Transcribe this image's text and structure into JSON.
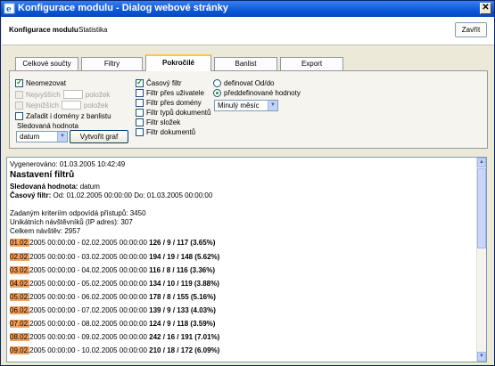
{
  "window": {
    "title": "Konfigurace modulu - Dialog webové stránky",
    "close_glyph": "✕"
  },
  "header": {
    "label": "Konfigurace modulu",
    "module": "Statistika",
    "close_button": "Zavřít"
  },
  "tabs": [
    {
      "label": "Celkové součty",
      "active": false
    },
    {
      "label": "Filtry",
      "active": false
    },
    {
      "label": "Pokročilé",
      "active": true
    },
    {
      "label": "Banlist",
      "active": false
    },
    {
      "label": "Export",
      "active": false
    }
  ],
  "options": {
    "neomezovat": "Neomezovat",
    "nejvyssich": "Nejvyšších",
    "nejnizsich": "Nejnižších",
    "polozek": "položek",
    "zaradit": "Zařadit i domény z banlistu",
    "sledovana_label": "Sledovaná hodnota",
    "sledovana_value": "datum",
    "vytvorit_graf": "Vytvořit graf",
    "casovy_filtr": "Časový filtr",
    "filtr_uzivatele": "Filtr přes uživatele",
    "filtr_domeny": "Filtr přes domény",
    "filtr_typu": "Filtr typů dokumentů",
    "filtr_slozek": "Filtr složek",
    "filtr_dokumentu": "Filtr dokumentů",
    "definovat_od_do": "definovat Od/do",
    "preddefinovane": "předdefinované hodnoty",
    "period_value": "Minulý měsíc"
  },
  "report": {
    "generated": "Vygenerováno: 01.03.2005 10:42:49",
    "heading": "Nastavení filtrů",
    "tracked_label": "Sledovaná hodnota:",
    "tracked_value": "datum",
    "time_filter_label": "Časový filtr:",
    "time_filter_value": "Od: 01.02.2005 00:00:00  Do: 01.03.2005 00:00:00",
    "matched": "Zadaným kriteriím odpovídá přístupů: 3450",
    "unique": "Unikátních návštěvníků (IP adres): 307",
    "total": "Celkem návštěv: 2957",
    "rows": [
      {
        "date": "01.02.",
        "rest": "2005 00:00:00 - 02.02.2005 00:00:00 ",
        "stats": "126 / 9 / 117 (3.65%)",
        "share": 3.65
      },
      {
        "date": "02.02.",
        "rest": "2005 00:00:00 - 03.02.2005 00:00:00 ",
        "stats": "194 / 19 / 148 (5.62%)",
        "share": 5.62
      },
      {
        "date": "03.02.",
        "rest": "2005 00:00:00 - 04.02.2005 00:00:00 ",
        "stats": "116 / 8 / 116 (3.36%)",
        "share": 3.36
      },
      {
        "date": "04.02.",
        "rest": "2005 00:00:00 - 05.02.2005 00:00:00 ",
        "stats": "134 / 10 / 119 (3.88%)",
        "share": 3.88
      },
      {
        "date": "05.02.",
        "rest": "2005 00:00:00 - 06.02.2005 00:00:00 ",
        "stats": "178 / 8 / 155 (5.16%)",
        "share": 5.16
      },
      {
        "date": "06.02.",
        "rest": "2005 00:00:00 - 07.02.2005 00:00:00 ",
        "stats": "139 / 9 / 133 (4.03%)",
        "share": 4.03
      },
      {
        "date": "07.02.",
        "rest": "2005 00:00:00 - 08.02.2005 00:00:00 ",
        "stats": "124 / 9 / 118 (3.59%)",
        "share": 3.59
      },
      {
        "date": "08.02.",
        "rest": "2005 00:00:00 - 09.02.2005 00:00:00 ",
        "stats": "242 / 16 / 191 (7.01%)",
        "share": 7.01
      },
      {
        "date": "09.02.",
        "rest": "2005 00:00:00 - 10.02.2005 00:00:00 ",
        "stats": "210 / 18 / 172 (6.09%)",
        "share": 6.09
      }
    ]
  },
  "colors": {
    "title_bar": "#0a58d8",
    "bar_fill": "#f4a05a",
    "tab_highlight": "#ffc83c"
  }
}
